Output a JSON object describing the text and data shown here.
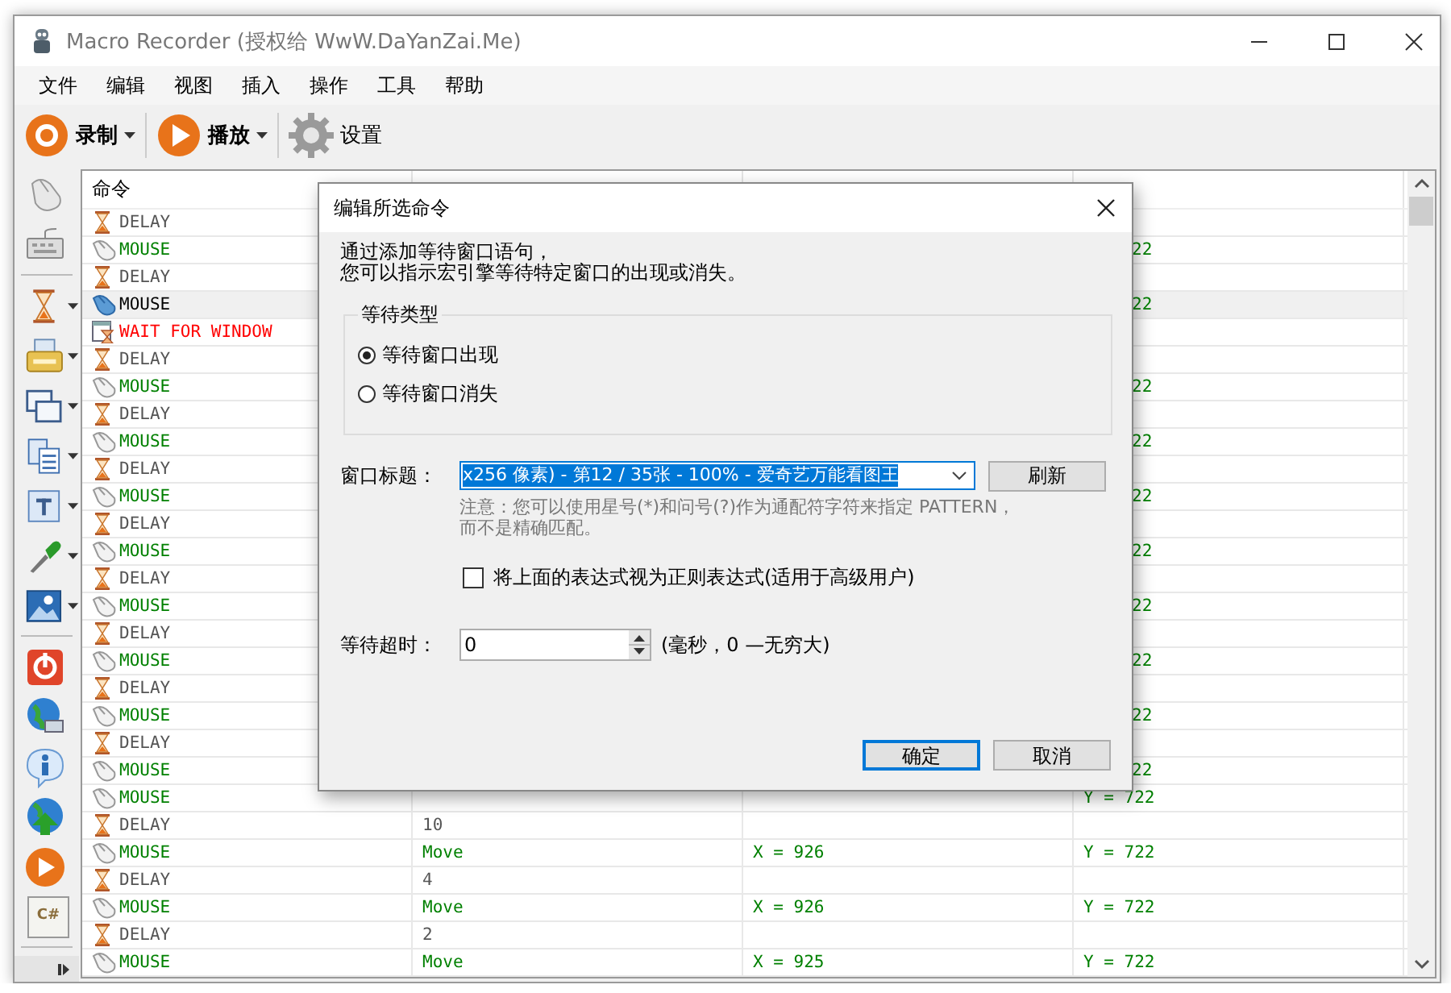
{
  "window": {
    "title": "Macro Recorder (授权给 WwW.DaYanZai.Me)"
  },
  "menu": [
    "文件",
    "编辑",
    "视图",
    "插入",
    "操作",
    "工具",
    "帮助"
  ],
  "toolbar": [
    {
      "kind": "record",
      "label": "录制",
      "dropdown": true
    },
    {
      "kind": "play",
      "label": "播放",
      "dropdown": true
    },
    {
      "kind": "settings",
      "label": "设置",
      "dropdown": false
    }
  ],
  "side_tools": [
    {
      "kind": "mouse",
      "dropdown": false
    },
    {
      "kind": "keyboard",
      "dropdown": false
    },
    {
      "kind": "separator"
    },
    {
      "kind": "hourglass",
      "dropdown": true
    },
    {
      "kind": "printer",
      "dropdown": true
    },
    {
      "kind": "windows",
      "dropdown": true
    },
    {
      "kind": "documents",
      "dropdown": true
    },
    {
      "kind": "text",
      "dropdown": true
    },
    {
      "kind": "pipette",
      "dropdown": true
    },
    {
      "kind": "image",
      "dropdown": true
    },
    {
      "kind": "separator"
    },
    {
      "kind": "power",
      "dropdown": false
    },
    {
      "kind": "globe",
      "dropdown": false
    },
    {
      "kind": "info",
      "dropdown": false
    },
    {
      "kind": "upload",
      "dropdown": false
    },
    {
      "kind": "play",
      "dropdown": false
    },
    {
      "kind": "code",
      "label": "C#",
      "dropdown": false
    },
    {
      "kind": "separator"
    },
    {
      "kind": "expand"
    }
  ],
  "table": {
    "columns": [
      "命令"
    ],
    "rows": [
      {
        "kind": "delay",
        "command": "DELAY",
        "selected": false
      },
      {
        "kind": "mouse",
        "command": "MOUSE",
        "selected": false,
        "covered": true,
        "column_4": "22"
      },
      {
        "kind": "delay",
        "command": "DELAY",
        "selected": false
      },
      {
        "kind": "mouse",
        "command": "MOUSE",
        "selected": true,
        "covered": true,
        "column_4": "22"
      },
      {
        "kind": "window",
        "command": "WAIT FOR WINDOW",
        "selected": false
      },
      {
        "kind": "delay",
        "command": "DELAY",
        "selected": false
      },
      {
        "kind": "mouse",
        "command": "MOUSE",
        "selected": false,
        "covered": true,
        "column_4": "22"
      },
      {
        "kind": "delay",
        "command": "DELAY",
        "selected": false
      },
      {
        "kind": "mouse",
        "command": "MOUSE",
        "selected": false,
        "covered": true,
        "column_4": "22"
      },
      {
        "kind": "delay",
        "command": "DELAY",
        "selected": false
      },
      {
        "kind": "mouse",
        "command": "MOUSE",
        "selected": false,
        "covered": true,
        "column_4": "22"
      },
      {
        "kind": "delay",
        "command": "DELAY",
        "selected": false
      },
      {
        "kind": "mouse",
        "command": "MOUSE",
        "selected": false,
        "covered": true,
        "column_4": "22"
      },
      {
        "kind": "delay",
        "command": "DELAY",
        "selected": false
      },
      {
        "kind": "mouse",
        "command": "MOUSE",
        "selected": false,
        "covered": true,
        "column_4": "22"
      },
      {
        "kind": "delay",
        "command": "DELAY",
        "selected": false
      },
      {
        "kind": "mouse",
        "command": "MOUSE",
        "selected": false,
        "covered": true,
        "column_4": "22"
      },
      {
        "kind": "delay",
        "command": "DELAY",
        "selected": false
      },
      {
        "kind": "mouse",
        "command": "MOUSE",
        "selected": false,
        "covered": true,
        "column_4": "22"
      },
      {
        "kind": "delay",
        "command": "DELAY",
        "selected": false
      },
      {
        "kind": "mouse",
        "command": "MOUSE",
        "selected": false,
        "covered": true,
        "column_4": "22"
      },
      {
        "kind": "mouse",
        "command": "MOUSE",
        "selected": false,
        "column_4": "Y = 722"
      },
      {
        "kind": "delay",
        "command": "DELAY",
        "selected": false,
        "column_2": "10"
      },
      {
        "kind": "mouse",
        "command": "MOUSE",
        "selected": false,
        "column_2": "Move",
        "column_3": "X = 926",
        "column_4": "Y = 722"
      },
      {
        "kind": "delay",
        "command": "DELAY",
        "selected": false,
        "column_2": "4"
      },
      {
        "kind": "mouse",
        "command": "MOUSE",
        "selected": false,
        "column_2": "Move",
        "column_3": "X = 926",
        "column_4": "Y = 722"
      },
      {
        "kind": "delay",
        "command": "DELAY",
        "selected": false,
        "column_2": "2"
      },
      {
        "kind": "mouse",
        "command": "MOUSE",
        "selected": false,
        "column_2": "Move",
        "column_3": "X = 925",
        "column_4": "Y = 722"
      }
    ]
  },
  "dialog": {
    "title": "编辑所选命令",
    "intro": [
      "通过添加等待窗口语句，",
      "您可以指示宏引擎等待特定窗口的出现或消失。"
    ],
    "group_label": "等待类型",
    "radios": [
      {
        "label": "等待窗口出现",
        "selected": true
      },
      {
        "label": "等待窗口消失",
        "selected": false
      }
    ],
    "window_title_label": "窗口标题：",
    "window_title_value": "x256 像素) - 第12 / 35张 - 100% - 爱奇艺万能看图王",
    "refresh_button": "刷新",
    "note": [
      "注意：您可以使用星号(*)和问号(?)作为通配符字符来指定 PATTERN，",
      "而不是精确匹配。"
    ],
    "regex_checkbox": {
      "label": "将上面的表达式视为正则表达式(适用于高级用户)",
      "checked": false
    },
    "timeout_label": "等待超时：",
    "timeout_value": "0",
    "timeout_hint": "(毫秒，0 —无穷大)",
    "buttons": [
      {
        "label": "确定",
        "default": true
      },
      {
        "label": "取消",
        "default": false
      }
    ]
  }
}
